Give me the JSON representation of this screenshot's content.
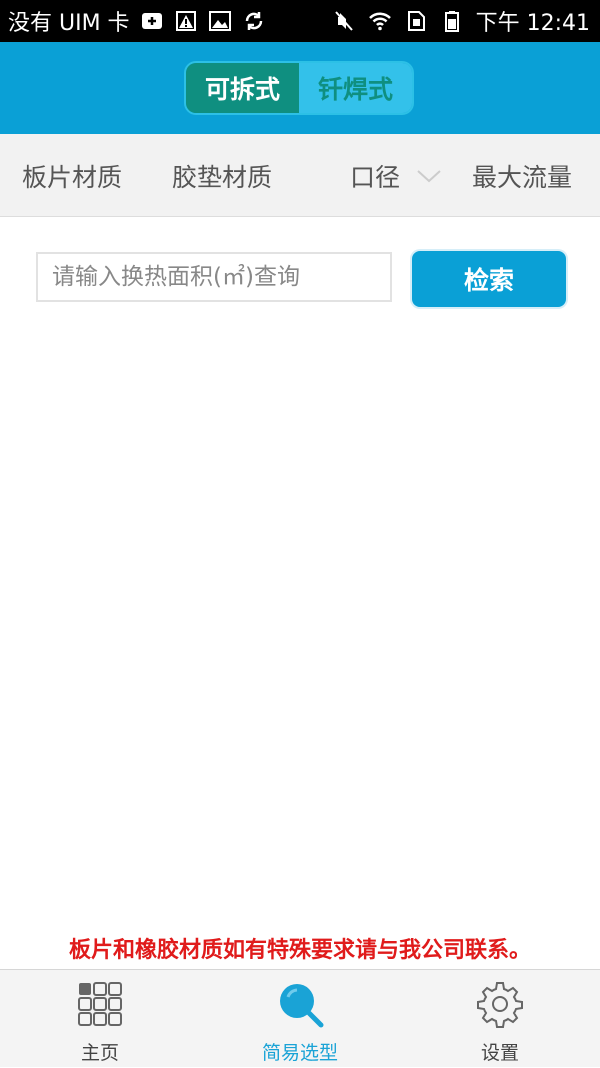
{
  "status_bar": {
    "carrier": "没有 UIM 卡",
    "time": "下午 12:41",
    "icons_left": [
      "add-icon",
      "warning-icon",
      "image-icon",
      "sync-icon"
    ],
    "icons_right": [
      "mute-icon",
      "wifi-icon",
      "sim-icon",
      "battery-icon"
    ]
  },
  "header": {
    "segments": [
      {
        "label": "可拆式",
        "active": true
      },
      {
        "label": "钎焊式",
        "active": false
      }
    ]
  },
  "filters": [
    {
      "label": "板片材质"
    },
    {
      "label": "胶垫材质"
    },
    {
      "label": "口径"
    },
    {
      "label": "最大流量"
    }
  ],
  "search": {
    "placeholder": "请输入换热面积(㎡)查询",
    "value": "",
    "button_label": "检索"
  },
  "notice": "板片和橡胶材质如有特殊要求请与我公司联系。",
  "tabs": [
    {
      "label": "主页",
      "icon": "grid-icon",
      "active": false
    },
    {
      "label": "简易选型",
      "icon": "search-icon",
      "active": true
    },
    {
      "label": "设置",
      "icon": "gear-icon",
      "active": false
    }
  ],
  "colors": {
    "primary": "#0aa0d6",
    "segment_active": "#0f8f80",
    "segment_inactive": "#33c1ea",
    "notice": "#e01b1b",
    "tab_active": "#1aa3d6"
  }
}
